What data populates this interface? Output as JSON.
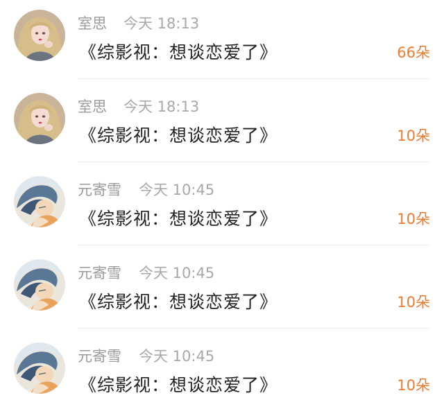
{
  "messages": [
    {
      "user": "室思",
      "time": "今天 18:13",
      "book_title": "《综影视：想谈恋爱了》",
      "gift": "66朵",
      "avatar_icon": "girl-avatar-icon"
    },
    {
      "user": "室思",
      "time": "今天 18:13",
      "book_title": "《综影视：想谈恋爱了》",
      "gift": "10朵",
      "avatar_icon": "girl-avatar-icon"
    },
    {
      "user": "元寄雪",
      "time": "今天 10:45",
      "book_title": "《综影视：想谈恋爱了》",
      "gift": "10朵",
      "avatar_icon": "boy-avatar-icon"
    },
    {
      "user": "元寄雪",
      "time": "今天 10:45",
      "book_title": "《综影视：想谈恋爱了》",
      "gift": "10朵",
      "avatar_icon": "boy-avatar-icon"
    },
    {
      "user": "元寄雪",
      "time": "今天 10:45",
      "book_title": "《综影视：想谈恋爱了》",
      "gift": "10朵",
      "avatar_icon": "boy-avatar-icon"
    }
  ],
  "colors": {
    "gift_orange": "#f07b2b",
    "name_gray": "#9a9a9a",
    "title_dark": "#222222"
  }
}
